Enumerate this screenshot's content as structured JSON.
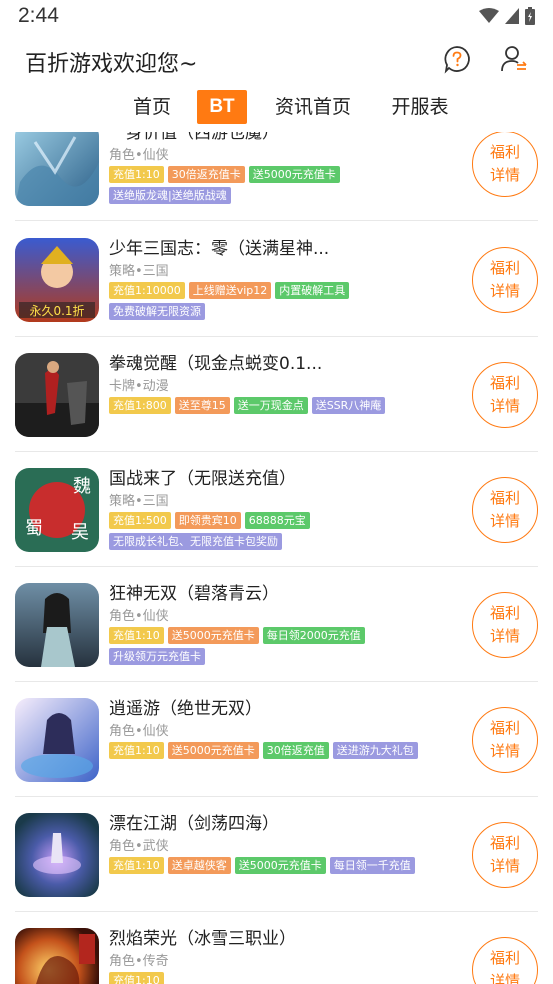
{
  "status": {
    "time": "2:44"
  },
  "header": {
    "title": "百折游戏欢迎您~"
  },
  "tabs": [
    {
      "label": "首页"
    },
    {
      "label": "BT"
    },
    {
      "label": "资讯首页"
    },
    {
      "label": "开服表"
    }
  ],
  "colors": {
    "accent": "#ff7a12",
    "tag_yellow": "#f2c94c",
    "tag_orange": "#f39a5a",
    "tag_green": "#5cc96a",
    "tag_purple": "#9b9ae0"
  },
  "welfare_button": {
    "line1": "福利",
    "line2": "详情"
  },
  "games": [
    {
      "name": "一身价值（西游也魔）",
      "category": "角色•仙侠",
      "tags": [
        {
          "text": "充值1:10",
          "color": "yellow"
        },
        {
          "text": "30倍返充值卡",
          "color": "orange"
        },
        {
          "text": "送5000元充值卡",
          "color": "green"
        }
      ],
      "tags2": [
        {
          "text": "送绝版龙魂|送绝版战魂",
          "color": "purple"
        }
      ]
    },
    {
      "name": "少年三国志：零（送满星神...",
      "category": "策略•三国",
      "tags": [
        {
          "text": "充值1:10000",
          "color": "yellow"
        },
        {
          "text": "上线赠送vip12",
          "color": "orange"
        },
        {
          "text": "内置破解工具",
          "color": "green"
        }
      ],
      "tags2": [
        {
          "text": "免费破解无限资源",
          "color": "purple"
        }
      ]
    },
    {
      "name": "拳魂觉醒（现金点蜕变0.1...",
      "category": "卡牌•动漫",
      "tags": [
        {
          "text": "充值1:800",
          "color": "yellow"
        },
        {
          "text": "送至尊15",
          "color": "orange"
        },
        {
          "text": "送一万现金点",
          "color": "green"
        },
        {
          "text": "送SSR八神庵",
          "color": "purple"
        }
      ],
      "tags2": []
    },
    {
      "name": "国战来了（无限送充值）",
      "category": "策略•三国",
      "tags": [
        {
          "text": "充值1:500",
          "color": "yellow"
        },
        {
          "text": "即领贵宾10",
          "color": "orange"
        },
        {
          "text": "68888元宝",
          "color": "green"
        }
      ],
      "tags2": [
        {
          "text": "无限成长礼包、无限充值卡包奖励",
          "color": "purple"
        }
      ]
    },
    {
      "name": "狂神无双（碧落青云）",
      "category": "角色•仙侠",
      "tags": [
        {
          "text": "充值1:10",
          "color": "yellow"
        },
        {
          "text": "送5000元充值卡",
          "color": "orange"
        },
        {
          "text": "每日领2000元充值",
          "color": "green"
        }
      ],
      "tags2": [
        {
          "text": "升级领万元充值卡",
          "color": "purple"
        }
      ]
    },
    {
      "name": "逍遥游（绝世无双）",
      "category": "角色•仙侠",
      "tags": [
        {
          "text": "充值1:10",
          "color": "yellow"
        },
        {
          "text": "送5000元充值卡",
          "color": "orange"
        },
        {
          "text": "30倍返充值",
          "color": "green"
        },
        {
          "text": "送进游九大礼包",
          "color": "purple"
        }
      ],
      "tags2": []
    },
    {
      "name": "漂在江湖（剑荡四海）",
      "category": "角色•武侠",
      "tags": [
        {
          "text": "充值1:10",
          "color": "yellow"
        },
        {
          "text": "送卓越侠客",
          "color": "orange"
        },
        {
          "text": "送5000元充值卡",
          "color": "green"
        },
        {
          "text": "每日领一千充值",
          "color": "purple"
        }
      ],
      "tags2": []
    },
    {
      "name": "烈焰荣光（冰雪三职业）",
      "category": "角色•传奇",
      "tags": [
        {
          "text": "充值1:10",
          "color": "yellow"
        }
      ],
      "tags2": []
    }
  ]
}
